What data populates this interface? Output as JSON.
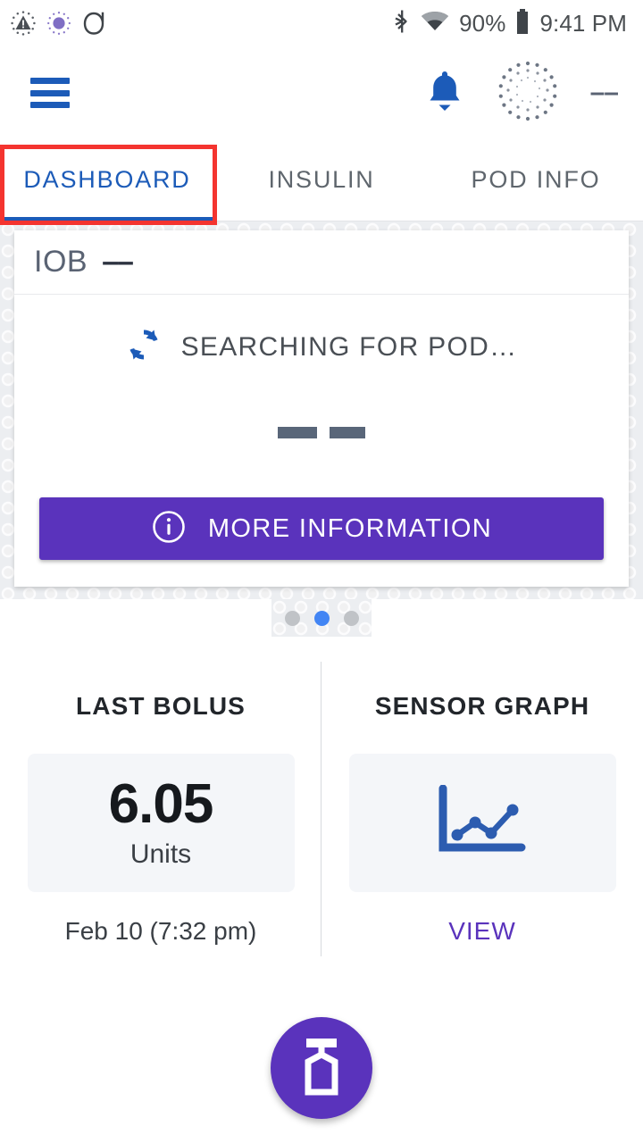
{
  "status_bar": {
    "icons_left": [
      "alert-dotted-icon",
      "purple-dot-dotted-icon",
      "pod-outline-icon"
    ],
    "bluetooth_icon": "bluetooth-icon",
    "wifi_icon": "wifi-icon",
    "battery_percent": "90%",
    "battery_icon": "battery-icon",
    "time": "9:41 PM"
  },
  "app_bar": {
    "menu_icon": "hamburger-menu-icon",
    "notifications_icon": "bell-icon",
    "pod_status_icon": "pod-searching-dotted-icon",
    "pod_status_value": "––"
  },
  "tabs": {
    "items": [
      {
        "label": "DASHBOARD",
        "active": true
      },
      {
        "label": "INSULIN",
        "active": false
      },
      {
        "label": "POD INFO",
        "active": false
      }
    ],
    "highlight_color": "#f4342f",
    "active_color": "#1c5bb8",
    "inactive_color": "#5f666d"
  },
  "pod_card": {
    "iob_label": "IOB",
    "iob_value": "––",
    "status_icon": "sync-refresh-icon",
    "status_text": "SEARCHING FOR POD…",
    "value_placeholder": "— —",
    "more_info_icon": "info-circle-icon",
    "more_info_label": "MORE INFORMATION",
    "button_color": "#5a33bc"
  },
  "pager": {
    "total": 3,
    "active_index": 1,
    "active_color": "#4285f4",
    "inactive_color": "#c0c3c7"
  },
  "panels": {
    "last_bolus": {
      "title": "LAST BOLUS",
      "value": "6.05",
      "unit": "Units",
      "timestamp": "Feb 10 (7:32 pm)"
    },
    "sensor_graph": {
      "title": "SENSOR GRAPH",
      "icon": "line-chart-icon",
      "action_label": "VIEW",
      "action_color": "#5a33bc"
    }
  },
  "fab": {
    "icon": "insulin-vial-icon",
    "color": "#5a33bc"
  }
}
